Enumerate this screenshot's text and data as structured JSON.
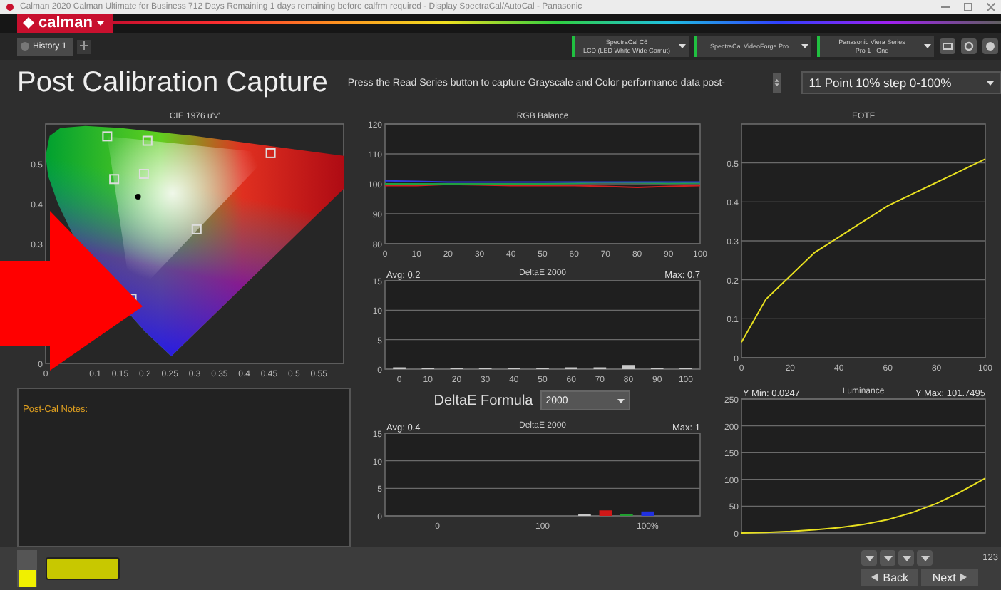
{
  "window": {
    "title": "Calman 2020 Calman Ultimate for Business 712 Days Remaining 1 days remaining before calfrm required - Display SpectraCal/AutoCal - Panasonic"
  },
  "app_menu": {
    "label": "calman"
  },
  "tabs": [
    {
      "label": "History 1",
      "selected": true
    }
  ],
  "devices": [
    {
      "name": "SpectraCal C6",
      "detail": "LCD (LED White Wide Gamut)"
    },
    {
      "name": "SpectraCal VideoForge Pro"
    },
    {
      "name": "Panasonic Viera Series",
      "detail": "Pro 1 - One"
    }
  ],
  "page": {
    "title": "Post Calibration Capture",
    "instructions": "Press the Read Series button to capture Grayscale and Color performance data post-",
    "series_select": "11 Point 10% step 0-100%"
  },
  "cie": {
    "title": "CIE 1976 u'v'",
    "x_labels": [
      "0",
      "0.1",
      "0.15",
      "0.2",
      "0.25",
      "0.3",
      "0.35",
      "0.4",
      "0.45",
      "0.5",
      "0.55"
    ],
    "y_labels": [
      "0.5",
      "0.4",
      "0.3",
      "0"
    ]
  },
  "notes": {
    "label": "Post-Cal Notes:"
  },
  "rgb_balance": {
    "chart_data": {
      "type": "line",
      "title": "RGB Balance",
      "grid": true,
      "x": [
        0,
        10,
        20,
        30,
        40,
        50,
        60,
        70,
        80,
        90,
        100
      ],
      "xlim": [
        0,
        100
      ],
      "ylim": [
        80,
        120
      ],
      "xticks": [
        0,
        10,
        20,
        30,
        40,
        50,
        60,
        70,
        80,
        90,
        100
      ],
      "yticks": [
        80,
        90,
        100,
        110,
        120
      ],
      "series": [
        {
          "color": "#d02020",
          "values": [
            99.4,
            99.4,
            99.8,
            99.6,
            99.4,
            99.4,
            99.4,
            99.2,
            98.8,
            99.2,
            99.4
          ]
        },
        {
          "color": "#20a040",
          "values": [
            100,
            100,
            100,
            100,
            100,
            100,
            100.2,
            100.5,
            100.4,
            100.2,
            100.3
          ]
        },
        {
          "color": "#3040e8",
          "values": [
            101,
            100.8,
            100.6,
            100.6,
            100.6,
            100.6,
            100.6,
            100.6,
            100.6,
            100.6,
            100.6
          ]
        }
      ]
    }
  },
  "grayscale_delta_e": {
    "left_note": "Avg: 0.2",
    "right_note": "Max: 0.7",
    "chart_data": {
      "type": "bar",
      "title": "DeltaE 2000",
      "grid": true,
      "x": [
        0,
        10,
        20,
        30,
        40,
        50,
        60,
        70,
        80,
        90,
        100
      ],
      "xlim": [
        -5,
        105
      ],
      "ylim": [
        0,
        15
      ],
      "xticks": [
        0,
        10,
        20,
        30,
        40,
        50,
        60,
        70,
        80,
        90,
        100
      ],
      "yticks": [
        0,
        5,
        10,
        15
      ],
      "series": [
        {
          "color": "#c8c8c8",
          "values": [
            0.3,
            0.2,
            0.2,
            0.2,
            0.2,
            0.2,
            0.3,
            0.3,
            0.7,
            0.2,
            0.2
          ]
        }
      ]
    }
  },
  "delta_e_formula": {
    "label": "DeltaE Formula",
    "value": "2000"
  },
  "color_delta_e": {
    "left_note": "Avg: 0.4",
    "right_note": "Max: 1",
    "chart_data": {
      "type": "bar",
      "title": "DeltaE 2000",
      "grid": true,
      "categories": [
        null,
        null,
        "0",
        null,
        null,
        null,
        null,
        "100",
        null,
        null,
        null,
        null,
        "100%",
        null,
        null
      ],
      "ylim": [
        0,
        15
      ],
      "yticks": [
        0,
        5,
        10,
        15
      ],
      "series": [
        {
          "color": "#c8c8c8",
          "values": [
            null,
            null,
            null,
            null,
            null,
            null,
            null,
            null,
            null,
            0.3,
            null,
            null,
            null,
            null,
            null
          ]
        },
        {
          "color": "#d01818",
          "values": [
            null,
            null,
            null,
            null,
            null,
            null,
            null,
            null,
            null,
            null,
            1,
            null,
            null,
            null,
            null
          ]
        },
        {
          "color": "#20a030",
          "values": [
            null,
            null,
            null,
            null,
            null,
            null,
            null,
            null,
            null,
            null,
            null,
            0.3,
            null,
            null,
            null
          ]
        },
        {
          "color": "#2030e0",
          "values": [
            null,
            null,
            null,
            null,
            null,
            null,
            null,
            null,
            null,
            null,
            null,
            null,
            0.8,
            null,
            null
          ]
        }
      ]
    }
  },
  "eotf": {
    "chart_data": {
      "type": "line",
      "title": "EOTF",
      "grid": true,
      "x": [
        0,
        10,
        20,
        30,
        40,
        50,
        60,
        70,
        80,
        90,
        100
      ],
      "xlim": [
        0,
        100
      ],
      "ylim": [
        0,
        0.6
      ],
      "xticks": [
        0,
        20,
        40,
        60,
        80,
        100
      ],
      "yticks": [
        0,
        0.1,
        0.2,
        0.3,
        0.4,
        0.5
      ],
      "series": [
        {
          "color": "#e8e020",
          "values": [
            0.04,
            0.15,
            0.21,
            0.27,
            0.31,
            0.35,
            0.39,
            0.42,
            0.45,
            0.48,
            0.51
          ]
        }
      ]
    }
  },
  "luminance": {
    "left_note": "Y Min: 0.0247",
    "right_note": "Y Max: 101.7495",
    "chart_data": {
      "type": "line",
      "title": "Luminance",
      "grid": true,
      "x": [
        0,
        10,
        20,
        30,
        40,
        50,
        60,
        70,
        80,
        90,
        100
      ],
      "xlim": [
        0,
        100
      ],
      "ylim": [
        0,
        250
      ],
      "yticks": [
        0,
        50,
        100,
        150,
        200,
        250
      ],
      "series": [
        {
          "color": "#e8e020",
          "values": [
            0,
            1,
            3,
            6,
            10,
            16,
            25,
            38,
            55,
            77,
            102
          ]
        }
      ]
    }
  },
  "bottom": {
    "nav": [
      "Back",
      "Next"
    ],
    "counter": "123"
  }
}
